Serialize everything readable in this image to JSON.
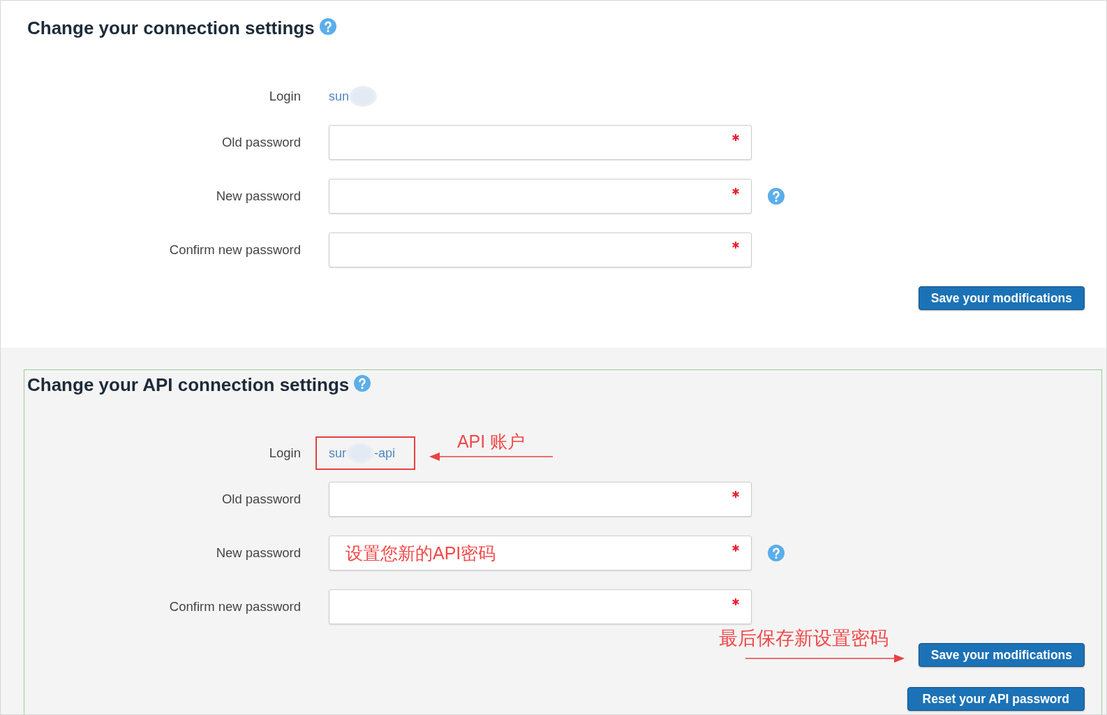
{
  "sections": [
    {
      "kind": "plain",
      "title": "Change your connection settings",
      "title_help": true,
      "login": {
        "label": "Login",
        "highlighted": false,
        "value": [
          {
            "kind": "text",
            "text": "sun"
          },
          {
            "kind": "redacted"
          }
        ]
      },
      "fields": [
        {
          "label": "Old password",
          "required": true,
          "help": false
        },
        {
          "label": "New password",
          "required": true,
          "help": true
        },
        {
          "label": "Confirm new password",
          "required": true,
          "help": false
        }
      ],
      "buttons": [
        {
          "kind": "save",
          "label": "Save your modifications"
        }
      ]
    },
    {
      "kind": "framed",
      "title": "Change your API connection settings",
      "title_help": true,
      "login": {
        "label": "Login",
        "highlighted": true,
        "note": "API 账户",
        "value": [
          {
            "kind": "text",
            "text": "sur"
          },
          {
            "kind": "redacted"
          },
          {
            "kind": "text",
            "text": "-api"
          }
        ]
      },
      "fields": [
        {
          "label": "Old password",
          "required": true,
          "help": false
        },
        {
          "label": "New password",
          "required": true,
          "help": true,
          "note": "设置您新的API密码"
        },
        {
          "label": "Confirm new password",
          "required": true,
          "help": false
        }
      ],
      "buttons": [
        {
          "kind": "save",
          "label": "Save your modifications",
          "note": "最后保存新设置密码"
        },
        {
          "kind": "reset",
          "label": "Reset your API password"
        }
      ]
    }
  ]
}
